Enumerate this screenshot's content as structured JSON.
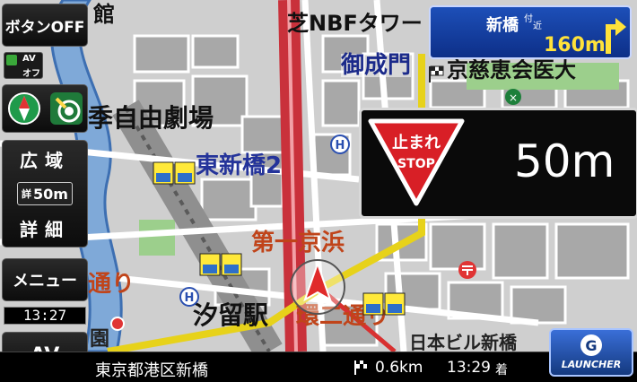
{
  "map": {
    "labels": {
      "shiba_nbf_tower": "芝NBFタワー",
      "onarimon": "御成門",
      "jikei_hospital": "京慈恵会医大",
      "kikiza": "季自由劇場",
      "higashi_shinbashi": "東新橋2",
      "daiichi_keihin": "第一京浜",
      "shiodome_station": "汐留駅",
      "kan2_dori": "環二通り",
      "dori_left": "通り",
      "hanshin": "館",
      "bottom_partial": "日本ビル新橋",
      "partial_left": "園"
    }
  },
  "side_buttons": {
    "button_off": "ボタンOFF",
    "av_off_top": "AV",
    "av_off_bottom": "オフ",
    "wide": "広域",
    "scale": "50m",
    "scale_prefix": "詳",
    "detail": "詳細",
    "menu": "メニュー",
    "clock": "13:27",
    "av": "AV"
  },
  "guidance": {
    "place": "新橋",
    "place_suffix_top": "付",
    "place_suffix_bottom": "近",
    "distance": "160m"
  },
  "stop_sign": {
    "sign_text_top": "止まれ",
    "sign_text_bottom": "STOP",
    "distance": "50m"
  },
  "status_bar": {
    "address": "東京都港区新橋",
    "remaining": "0.6km",
    "eta": "13:29",
    "eta_suffix": "着"
  },
  "launcher": {
    "letter": "G",
    "label": "LAUNCHER"
  }
}
